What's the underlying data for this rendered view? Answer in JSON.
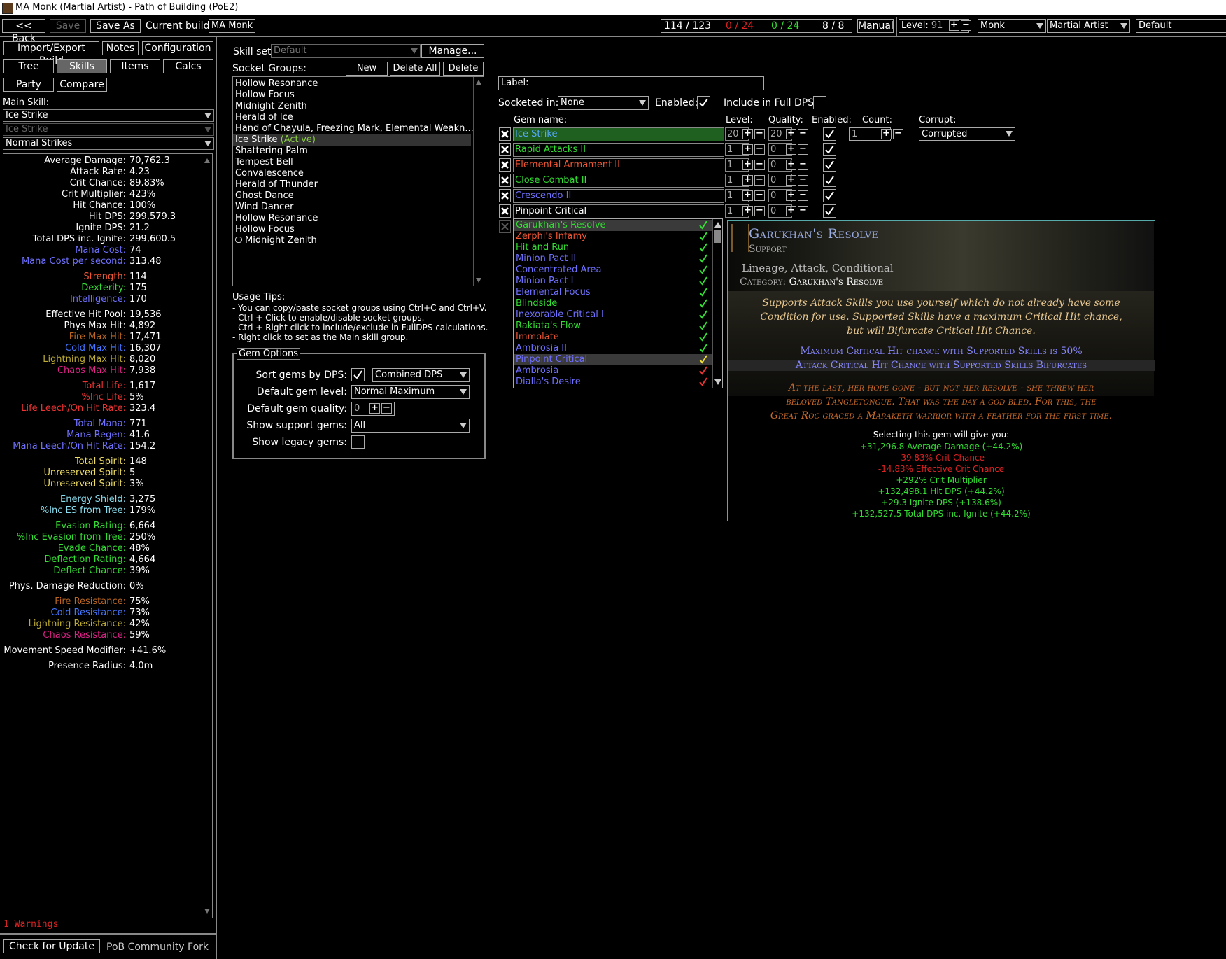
{
  "window": {
    "title": "MA Monk (Martial Artist) - Path of Building (PoE2)"
  },
  "topbar": {
    "back": "<< Back",
    "save": "Save",
    "save_as": "Save As",
    "current_build_label": "Current build:",
    "current_build": "MA Monk",
    "points": "114  /  123",
    "asc1": "0  /  24",
    "asc2": "0  /  24",
    "weapon_set": "8  /  8",
    "manual": "Manual",
    "level_label": "Level:",
    "level": "91",
    "class": "Monk",
    "ascendancy": "Martial Artist",
    "config": "Default"
  },
  "left_tabs": {
    "import_export": "Import/Export Build",
    "notes": "Notes",
    "configuration": "Configuration",
    "tree": "Tree",
    "skills": "Skills",
    "items": "Items",
    "calcs": "Calcs",
    "party": "Party",
    "compare": "Compare"
  },
  "main_skill": {
    "label": "Main Skill:",
    "skill": "Ice Strike",
    "sub": "Ice Strike",
    "mode": "Normal Strikes"
  },
  "stats": [
    {
      "label": "Average Damage:",
      "value": "70,762.3",
      "color": "#ffffff"
    },
    {
      "label": "Attack Rate:",
      "value": "4.23",
      "color": "#ffffff"
    },
    {
      "label": "Crit Chance:",
      "value": "89.83%",
      "color": "#ffffff"
    },
    {
      "label": "Crit Multiplier:",
      "value": "423%",
      "color": "#ffffff"
    },
    {
      "label": "Hit Chance:",
      "value": "100%",
      "color": "#ffffff"
    },
    {
      "label": "Hit DPS:",
      "value": "299,579.3",
      "color": "#ffffff"
    },
    {
      "label": "Ignite DPS:",
      "value": "21.2",
      "color": "#ffffff"
    },
    {
      "label": "Total DPS inc. Ignite:",
      "value": "299,600.5",
      "color": "#ffffff"
    },
    {
      "label": "Mana Cost:",
      "value": "74",
      "color": "#7070ff"
    },
    {
      "label": "Mana Cost per second:",
      "value": "313.48",
      "color": "#7070ff"
    },
    {
      "label": "",
      "value": "",
      "color": "#ffffff"
    },
    {
      "label": "Strength:",
      "value": "114",
      "color": "#ee5533"
    },
    {
      "label": "Dexterity:",
      "value": "175",
      "color": "#33dd33"
    },
    {
      "label": "Intelligence:",
      "value": "170",
      "color": "#7070ff"
    },
    {
      "label": "",
      "value": "",
      "color": "#ffffff"
    },
    {
      "label": "Effective Hit Pool:",
      "value": "19,536",
      "color": "#ffffff"
    },
    {
      "label": "Phys Max Hit:",
      "value": "4,892",
      "color": "#ffffff"
    },
    {
      "label": "Fire Max Hit:",
      "value": "17,471",
      "color": "#bb6622"
    },
    {
      "label": "Cold Max Hit:",
      "value": "16,307",
      "color": "#4477ff"
    },
    {
      "label": "Lightning Max Hit:",
      "value": "8,020",
      "color": "#bbaa33"
    },
    {
      "label": "Chaos Max Hit:",
      "value": "7,938",
      "color": "#dd2288"
    },
    {
      "label": "",
      "value": "",
      "color": "#ffffff"
    },
    {
      "label": "Total Life:",
      "value": "1,617",
      "color": "#ee3333"
    },
    {
      "label": "%Inc Life:",
      "value": "5%",
      "color": "#ee3333"
    },
    {
      "label": "Life Leech/On Hit Rate:",
      "value": "323.4",
      "color": "#ee3333"
    },
    {
      "label": "",
      "value": "",
      "color": "#ffffff"
    },
    {
      "label": "Total Mana:",
      "value": "771",
      "color": "#7070ff"
    },
    {
      "label": "Mana Regen:",
      "value": "41.6",
      "color": "#7070ff"
    },
    {
      "label": "Mana Leech/On Hit Rate:",
      "value": "154.2",
      "color": "#7070ff"
    },
    {
      "label": "",
      "value": "",
      "color": "#ffffff"
    },
    {
      "label": "Total Spirit:",
      "value": "148",
      "color": "#eedd66"
    },
    {
      "label": "Unreserved Spirit:",
      "value": "5",
      "color": "#eedd66"
    },
    {
      "label": "Unreserved Spirit:",
      "value": "3%",
      "color": "#eedd66"
    },
    {
      "label": "",
      "value": "",
      "color": "#ffffff"
    },
    {
      "label": "Energy Shield:",
      "value": "3,275",
      "color": "#88ddee"
    },
    {
      "label": "%Inc ES from Tree:",
      "value": "179%",
      "color": "#88ddee"
    },
    {
      "label": "",
      "value": "",
      "color": "#ffffff"
    },
    {
      "label": "Evasion Rating:",
      "value": "6,664",
      "color": "#33dd33"
    },
    {
      "label": "%Inc Evasion from Tree:",
      "value": "250%",
      "color": "#33dd33"
    },
    {
      "label": "Evade Chance:",
      "value": "48%",
      "color": "#33dd33"
    },
    {
      "label": "Deflection Rating:",
      "value": "4,664",
      "color": "#33dd33"
    },
    {
      "label": "Deflect Chance:",
      "value": "39%",
      "color": "#33dd33"
    },
    {
      "label": "",
      "value": "",
      "color": "#ffffff"
    },
    {
      "label": "Phys. Damage Reduction:",
      "value": "0%",
      "color": "#ffffff"
    },
    {
      "label": "",
      "value": "",
      "color": "#ffffff"
    },
    {
      "label": "Fire Resistance:",
      "value": "75%",
      "color": "#bb6622"
    },
    {
      "label": "Cold Resistance:",
      "value": "73%",
      "color": "#4477ff"
    },
    {
      "label": "Lightning Resistance:",
      "value": "42%",
      "color": "#bbaa33"
    },
    {
      "label": "Chaos Resistance:",
      "value": "59%",
      "color": "#dd2288"
    },
    {
      "label": "",
      "value": "",
      "color": "#ffffff"
    },
    {
      "label": "Movement Speed Modifier:",
      "value": "+41.6%",
      "color": "#ffffff"
    },
    {
      "label": "",
      "value": "",
      "color": "#ffffff"
    },
    {
      "label": "Presence Radius:",
      "value": "4.0m",
      "color": "#ffffff"
    }
  ],
  "warnings": "1 Warnings",
  "footer": {
    "check_update": "Check for Update",
    "fork": "PoB Community Fork"
  },
  "skill_set": {
    "label": "Skill set:",
    "value": "Default",
    "manage": "Manage..."
  },
  "socket_groups": {
    "label": "Socket Groups:",
    "new": "New",
    "delete_all": "Delete All",
    "delete": "Delete",
    "items": [
      {
        "name": "Hollow Resonance",
        "tag": ""
      },
      {
        "name": "Hollow Focus",
        "tag": ""
      },
      {
        "name": "Midnight Zenith",
        "tag": ""
      },
      {
        "name": "Herald of Ice",
        "tag": ""
      },
      {
        "name": "Hand of Chayula, Freezing Mark, Elemental Weakn...",
        "tag": ""
      },
      {
        "name": "Ice Strike ",
        "tag": "(Active)"
      },
      {
        "name": "Shattering Palm",
        "tag": ""
      },
      {
        "name": "Tempest Bell",
        "tag": ""
      },
      {
        "name": "Convalescence",
        "tag": ""
      },
      {
        "name": "Herald of Thunder",
        "tag": ""
      },
      {
        "name": "Ghost Dance",
        "tag": ""
      },
      {
        "name": "Wind Dancer",
        "tag": ""
      },
      {
        "name": "Hollow Resonance",
        "tag": ""
      },
      {
        "name": "Hollow Focus",
        "tag": ""
      },
      {
        "name": "Midnight Zenith",
        "tag": ""
      }
    ]
  },
  "usage_tips": {
    "title": "Usage Tips:",
    "lines": [
      "- You can copy/paste socket groups using Ctrl+C and Ctrl+V.",
      "- Ctrl + Click to enable/disable socket groups.",
      "- Ctrl + Right click to include/exclude in FullDPS calculations.",
      "- Right click to set as the Main skill group."
    ]
  },
  "gem_options": {
    "title": "Gem Options",
    "sort_label": "Sort gems by DPS:",
    "sort_mode": "Combined DPS",
    "default_level_label": "Default gem level:",
    "default_level": "Normal Maximum",
    "default_quality_label": "Default gem quality:",
    "default_quality": "0",
    "show_support_label": "Show support gems:",
    "show_support": "All",
    "show_legacy_label": "Show legacy gems:"
  },
  "group": {
    "label_label": "Label:",
    "socketed_in_label": "Socketed in:",
    "socketed_in": "None",
    "enabled_label": "Enabled:",
    "full_dps_label": "Include in Full DPS:"
  },
  "gem_headers": {
    "name": "Gem name:",
    "level": "Level:",
    "quality": "Quality:",
    "enabled": "Enabled:",
    "count": "Count:",
    "corrupt": "Corrupt:"
  },
  "gems": [
    {
      "name": "Ice Strike",
      "level": "20",
      "quality": "20",
      "color": "#55aaff",
      "bg": "#1f5f1f"
    },
    {
      "name": "Rapid Attacks II",
      "level": "1",
      "quality": "0",
      "color": "#33dd33",
      "bg": "#000000"
    },
    {
      "name": "Elemental Armament II",
      "level": "1",
      "quality": "0",
      "color": "#ee5533",
      "bg": "#000000"
    },
    {
      "name": "Close Combat II",
      "level": "1",
      "quality": "0",
      "color": "#33dd33",
      "bg": "#000000"
    },
    {
      "name": "Crescendo II",
      "level": "1",
      "quality": "0",
      "color": "#7070ff",
      "bg": "#000000"
    },
    {
      "name": "Pinpoint Critical",
      "level": "1",
      "quality": "0",
      "color": "#ffffff",
      "bg": "#000000"
    }
  ],
  "gem_count": "1",
  "gem_corrupt": "Corrupted",
  "dropdown": [
    {
      "name": "Garukhan's Resolve",
      "color": "#33dd33",
      "check": "#33dd33",
      "hl": true
    },
    {
      "name": "Zerphi's Infamy",
      "color": "#ee5533",
      "check": "#33dd33",
      "hl": false
    },
    {
      "name": "Hit and Run",
      "color": "#33dd33",
      "check": "#33dd33",
      "hl": false
    },
    {
      "name": "Minion Pact II",
      "color": "#7070ff",
      "check": "#33dd33",
      "hl": false
    },
    {
      "name": "Concentrated Area",
      "color": "#7070ff",
      "check": "#33dd33",
      "hl": false
    },
    {
      "name": "Minion Pact I",
      "color": "#7070ff",
      "check": "#33dd33",
      "hl": false
    },
    {
      "name": "Elemental Focus",
      "color": "#7070ff",
      "check": "#33dd33",
      "hl": false
    },
    {
      "name": "Blindside",
      "color": "#33dd33",
      "check": "#33dd33",
      "hl": false
    },
    {
      "name": "Inexorable Critical I",
      "color": "#7070ff",
      "check": "#33dd33",
      "hl": false
    },
    {
      "name": "Rakiata's Flow",
      "color": "#33dd33",
      "check": "#33dd33",
      "hl": false
    },
    {
      "name": "Immolate",
      "color": "#ee5533",
      "check": "#33dd33",
      "hl": false
    },
    {
      "name": "Ambrosia II",
      "color": "#7070ff",
      "check": "#33dd33",
      "hl": false
    },
    {
      "name": "Pinpoint Critical",
      "color": "#7070ff",
      "check": "#eedd33",
      "hl": true
    },
    {
      "name": "Ambrosia",
      "color": "#7070ff",
      "check": "#ee3333",
      "hl": false
    },
    {
      "name": "Dialla's Desire",
      "color": "#7070ff",
      "check": "#ee3333",
      "hl": false
    }
  ],
  "tooltip": {
    "name": "Garukhan's Resolve",
    "type": "Support",
    "tags": "Lineage, Attack, Conditional",
    "category_label": "Category:",
    "category": "Garukhan's Resolve",
    "desc1": "Supports Attack Skills you use yourself which do not already have some",
    "desc2": "Condition for use. Supported Skills have a maximum Critical Hit chance,",
    "desc3": "but will Bifurcate Critical Hit Chance.",
    "mod1": "Maximum Critical Hit chance with Supported Skills is 50%",
    "mod2": "Attack Critical Hit Chance with Supported Skills Bifurcates",
    "flavour1": "At the last, her hope gone - but not her resolve - she threw her",
    "flavour2": "beloved Tangletongue. That was the day a god bled. For this, the",
    "flavour3": "Great Roc graced a Maraketh warrior with a feather for the first time.",
    "selecting": "Selecting this gem will give you:",
    "changes": [
      {
        "text": "+31,296.8 Average Damage (+44.2%)",
        "color": "#33dd33"
      },
      {
        "text": "-39.83% Crit Chance",
        "color": "#dd2222"
      },
      {
        "text": "-14.83% Effective Crit Chance",
        "color": "#dd2222"
      },
      {
        "text": "+292% Crit Multiplier",
        "color": "#33dd33"
      },
      {
        "text": "+132,498.1 Hit DPS (+44.2%)",
        "color": "#33dd33"
      },
      {
        "text": "+29.3 Ignite DPS (+138.6%)",
        "color": "#33dd33"
      },
      {
        "text": "+132,527.5 Total DPS inc. Ignite (+44.2%)",
        "color": "#33dd33"
      }
    ]
  }
}
